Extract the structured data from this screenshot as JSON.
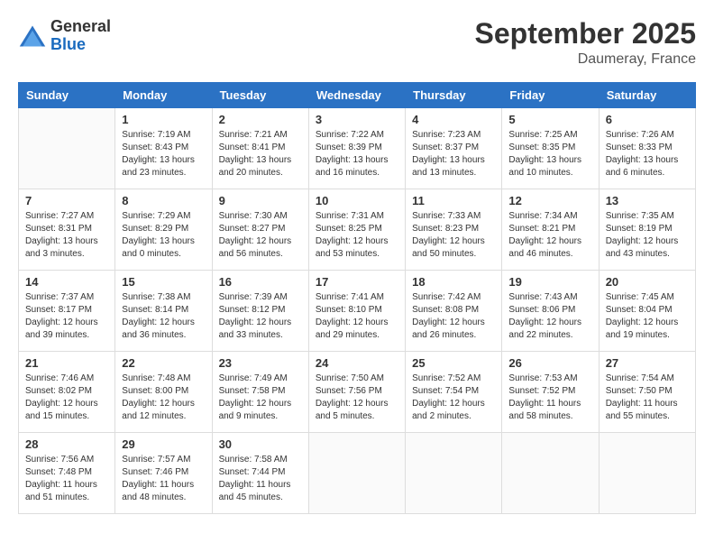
{
  "header": {
    "logo_line1": "General",
    "logo_line2": "Blue",
    "month": "September 2025",
    "location": "Daumeray, France"
  },
  "days_of_week": [
    "Sunday",
    "Monday",
    "Tuesday",
    "Wednesday",
    "Thursday",
    "Friday",
    "Saturday"
  ],
  "weeks": [
    [
      {
        "day": "",
        "info": ""
      },
      {
        "day": "1",
        "info": "Sunrise: 7:19 AM\nSunset: 8:43 PM\nDaylight: 13 hours\nand 23 minutes."
      },
      {
        "day": "2",
        "info": "Sunrise: 7:21 AM\nSunset: 8:41 PM\nDaylight: 13 hours\nand 20 minutes."
      },
      {
        "day": "3",
        "info": "Sunrise: 7:22 AM\nSunset: 8:39 PM\nDaylight: 13 hours\nand 16 minutes."
      },
      {
        "day": "4",
        "info": "Sunrise: 7:23 AM\nSunset: 8:37 PM\nDaylight: 13 hours\nand 13 minutes."
      },
      {
        "day": "5",
        "info": "Sunrise: 7:25 AM\nSunset: 8:35 PM\nDaylight: 13 hours\nand 10 minutes."
      },
      {
        "day": "6",
        "info": "Sunrise: 7:26 AM\nSunset: 8:33 PM\nDaylight: 13 hours\nand 6 minutes."
      }
    ],
    [
      {
        "day": "7",
        "info": "Sunrise: 7:27 AM\nSunset: 8:31 PM\nDaylight: 13 hours\nand 3 minutes."
      },
      {
        "day": "8",
        "info": "Sunrise: 7:29 AM\nSunset: 8:29 PM\nDaylight: 13 hours\nand 0 minutes."
      },
      {
        "day": "9",
        "info": "Sunrise: 7:30 AM\nSunset: 8:27 PM\nDaylight: 12 hours\nand 56 minutes."
      },
      {
        "day": "10",
        "info": "Sunrise: 7:31 AM\nSunset: 8:25 PM\nDaylight: 12 hours\nand 53 minutes."
      },
      {
        "day": "11",
        "info": "Sunrise: 7:33 AM\nSunset: 8:23 PM\nDaylight: 12 hours\nand 50 minutes."
      },
      {
        "day": "12",
        "info": "Sunrise: 7:34 AM\nSunset: 8:21 PM\nDaylight: 12 hours\nand 46 minutes."
      },
      {
        "day": "13",
        "info": "Sunrise: 7:35 AM\nSunset: 8:19 PM\nDaylight: 12 hours\nand 43 minutes."
      }
    ],
    [
      {
        "day": "14",
        "info": "Sunrise: 7:37 AM\nSunset: 8:17 PM\nDaylight: 12 hours\nand 39 minutes."
      },
      {
        "day": "15",
        "info": "Sunrise: 7:38 AM\nSunset: 8:14 PM\nDaylight: 12 hours\nand 36 minutes."
      },
      {
        "day": "16",
        "info": "Sunrise: 7:39 AM\nSunset: 8:12 PM\nDaylight: 12 hours\nand 33 minutes."
      },
      {
        "day": "17",
        "info": "Sunrise: 7:41 AM\nSunset: 8:10 PM\nDaylight: 12 hours\nand 29 minutes."
      },
      {
        "day": "18",
        "info": "Sunrise: 7:42 AM\nSunset: 8:08 PM\nDaylight: 12 hours\nand 26 minutes."
      },
      {
        "day": "19",
        "info": "Sunrise: 7:43 AM\nSunset: 8:06 PM\nDaylight: 12 hours\nand 22 minutes."
      },
      {
        "day": "20",
        "info": "Sunrise: 7:45 AM\nSunset: 8:04 PM\nDaylight: 12 hours\nand 19 minutes."
      }
    ],
    [
      {
        "day": "21",
        "info": "Sunrise: 7:46 AM\nSunset: 8:02 PM\nDaylight: 12 hours\nand 15 minutes."
      },
      {
        "day": "22",
        "info": "Sunrise: 7:48 AM\nSunset: 8:00 PM\nDaylight: 12 hours\nand 12 minutes."
      },
      {
        "day": "23",
        "info": "Sunrise: 7:49 AM\nSunset: 7:58 PM\nDaylight: 12 hours\nand 9 minutes."
      },
      {
        "day": "24",
        "info": "Sunrise: 7:50 AM\nSunset: 7:56 PM\nDaylight: 12 hours\nand 5 minutes."
      },
      {
        "day": "25",
        "info": "Sunrise: 7:52 AM\nSunset: 7:54 PM\nDaylight: 12 hours\nand 2 minutes."
      },
      {
        "day": "26",
        "info": "Sunrise: 7:53 AM\nSunset: 7:52 PM\nDaylight: 11 hours\nand 58 minutes."
      },
      {
        "day": "27",
        "info": "Sunrise: 7:54 AM\nSunset: 7:50 PM\nDaylight: 11 hours\nand 55 minutes."
      }
    ],
    [
      {
        "day": "28",
        "info": "Sunrise: 7:56 AM\nSunset: 7:48 PM\nDaylight: 11 hours\nand 51 minutes."
      },
      {
        "day": "29",
        "info": "Sunrise: 7:57 AM\nSunset: 7:46 PM\nDaylight: 11 hours\nand 48 minutes."
      },
      {
        "day": "30",
        "info": "Sunrise: 7:58 AM\nSunset: 7:44 PM\nDaylight: 11 hours\nand 45 minutes."
      },
      {
        "day": "",
        "info": ""
      },
      {
        "day": "",
        "info": ""
      },
      {
        "day": "",
        "info": ""
      },
      {
        "day": "",
        "info": ""
      }
    ]
  ]
}
